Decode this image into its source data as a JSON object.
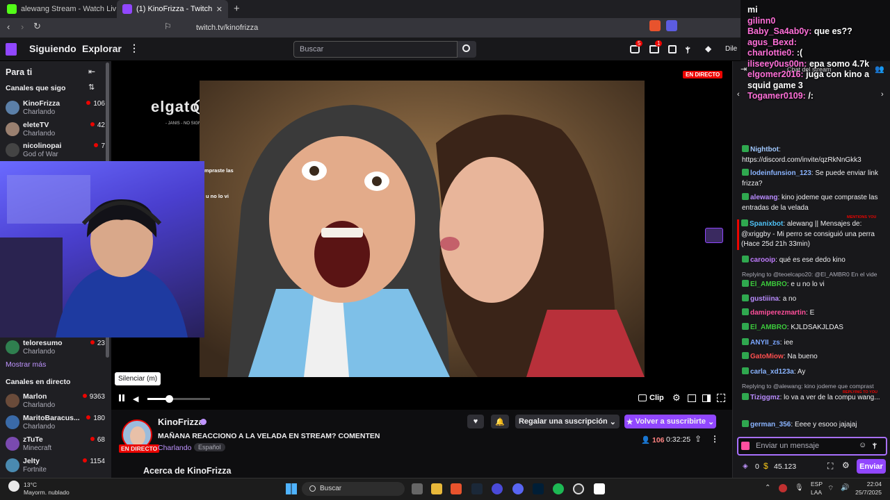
{
  "browser": {
    "tabs": [
      {
        "title": "alewang Stream - Watch Live on Kick"
      },
      {
        "title": "(1) KinoFrizza - Twitch"
      }
    ],
    "url": "twitch.tv/kinofrizza"
  },
  "topnav": {
    "following": "Siguiendo",
    "explore": "Explorar",
    "search_placeholder": "Buscar",
    "notif_count": "5",
    "inbox_count": "1",
    "ad_text": "Dile adiós a los anuncios de forma gratuita"
  },
  "sidebar": {
    "title": "Para ti",
    "followed_header": "Canales que sigo",
    "followed": [
      {
        "name": "KinoFrizza",
        "category": "Charlando",
        "viewers": "106",
        "avatar_color": "#5b7fa8"
      },
      {
        "name": "eleteTV",
        "category": "Charlando",
        "viewers": "42",
        "avatar_color": "#9a8070"
      },
      {
        "name": "nicolinopai",
        "category": "God of War",
        "viewers": "7",
        "avatar_color": "#444"
      },
      {
        "name": "teloresumo",
        "category": "Charlando",
        "viewers": "23",
        "avatar_color": "#2f7f4f"
      }
    ],
    "show_more": "Mostrar más",
    "live_header": "Canales en directo",
    "live": [
      {
        "name": "Marlon",
        "category": "Charlando",
        "viewers": "9363",
        "avatar_color": "#6a4b3a"
      },
      {
        "name": "MaritoBaracus...",
        "category": "Charlando",
        "viewers": "180",
        "avatar_color": "#3a6aa8"
      },
      {
        "name": "zTuTe",
        "category": "Minecraft",
        "viewers": "68",
        "avatar_color": "#7a4ab0"
      },
      {
        "name": "Jelty",
        "category": "Fortnite",
        "viewers": "1154",
        "avatar_color": "#4a8ab0"
      }
    ]
  },
  "player": {
    "live_badge": "EN DIRECTO",
    "elgato_text": "elgato",
    "elgato_sub": "- JANIS - NO SIGNAL -",
    "overlay_line1": "mpraste las",
    "overlay_line2": "u no lo vi",
    "mute_tooltip": "Silenciar (m)",
    "clip_label": "Clip",
    "volume": 0.6
  },
  "stream_info": {
    "channel": "KinoFrizza",
    "title": "MAÑANA REACCIONO A LA VELADA EN STREAM? COMENTEN",
    "category": "Charlando",
    "tag": "Español",
    "live_badge": "EN DIRECTO",
    "gift_sub": "Regalar una suscripción",
    "resub": "Volver a suscribirte",
    "viewers": "106",
    "uptime": "0:32:25",
    "about": "Acerca de KinoFrizza"
  },
  "overlay_chat": [
    {
      "user": "",
      "text": "mi"
    },
    {
      "user": "gilinn0",
      "text": ""
    },
    {
      "user": "Baby_Sa4ab0y:",
      "text": "que es??"
    },
    {
      "user": "agus_Bexd:",
      "text": ""
    },
    {
      "user": "charlottie0:",
      "text": ":("
    },
    {
      "user": "iliseey0us00n:",
      "text": "epa somo 4.7k"
    },
    {
      "user": "elgomer2016:",
      "text": "juga con kino a squid game 3"
    },
    {
      "user": "Togamer0109:",
      "text": "/:"
    }
  ],
  "chat": {
    "header": "Chat del stream",
    "messages": [
      {
        "user": "Nightbot",
        "text": "https://discord.com/invite/qzRkNnGkk3",
        "color": "#a0c8ff"
      },
      {
        "user": "lodeinfunsion_123",
        "text": "Se puede enviar link frizza?",
        "color": "#8ab4ff"
      },
      {
        "user": "alewang",
        "text": "kino jodeme que compraste las entradas de la velada",
        "color": "#b98cff"
      },
      {
        "user": "Spanixbot",
        "text": "alewang || Mensajes de: @xriggby - Mi perro se consiguió una perra (Hace 25d 21h 33min)",
        "color": "#4fc3f7"
      },
      {
        "user": "carooip",
        "text": "qué es ese dedo kino",
        "color": "#c07cff"
      },
      {
        "reply": "Replying to @teoelcapo20: @El_AMBR0 En el vide"
      },
      {
        "user": "El_AMBRO",
        "text": "e u no lo vi",
        "color": "#3cc93c"
      },
      {
        "user": "gustiiina",
        "text": "a no",
        "color": "#b98cff"
      },
      {
        "user": "damiperezmartin",
        "text": "E",
        "color": "#ff4f9a"
      },
      {
        "user": "El_AMBRO",
        "text": "KJLDSAKJLDAS",
        "color": "#3cc93c"
      },
      {
        "user": "ANYII_zs",
        "text": "iee",
        "color": "#7aa6ff"
      },
      {
        "user": "GatoMiow",
        "text": "Na bueno",
        "color": "#ff4f4f"
      },
      {
        "user": "carla_xd123a",
        "text": "Ay",
        "color": "#8ab4ff"
      },
      {
        "reply": "Replying to @alewang: kino jodeme que comprast"
      },
      {
        "user": "Tiziggmz",
        "text": "lo va a ver de la compu wang...",
        "color": "#b98cff"
      },
      {
        "user": "german_356",
        "text": "Eeee y esooo jajajaj",
        "color": "#8ab4ff"
      }
    ],
    "input_placeholder": "Enviar un mensaje",
    "points": "0",
    "bits": "45.123",
    "send": "Enviar",
    "mention_tag": "MENTIONS YOU",
    "reply_tag": "REPLYING TO YOU"
  },
  "taskbar": {
    "weather_temp": "13°C",
    "weather_desc": "Mayorm. nublado",
    "search": "Buscar",
    "lang1": "ESP",
    "lang2": "LAA",
    "time": "22:04",
    "date": "25/7/2025"
  }
}
